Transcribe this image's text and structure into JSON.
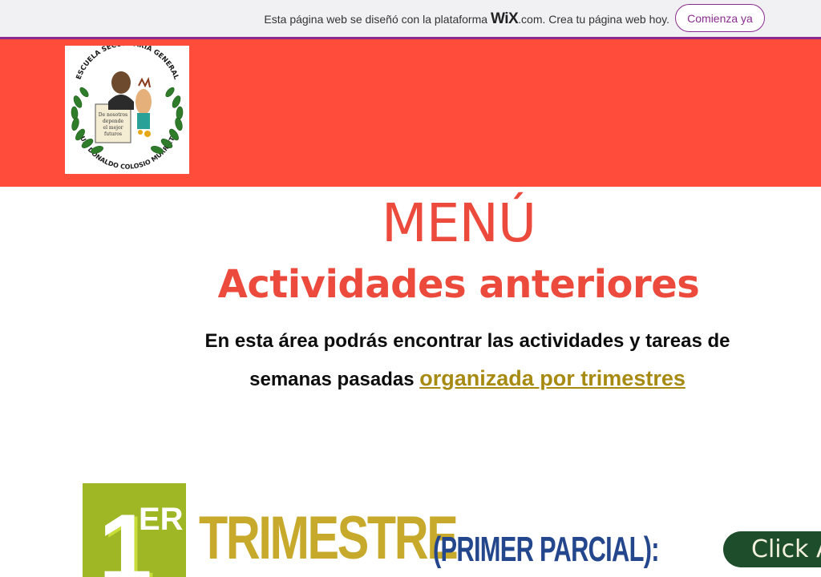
{
  "wix_banner": {
    "message_before": "Esta página web se diseñó con la plataforma ",
    "brand": "WiX",
    "message_after": ".com. Crea tu página web hoy.",
    "cta_label": "Comienza ya",
    "accent_color": "#8a2c8f"
  },
  "header": {
    "background_color": "#ff4c3b",
    "logo": {
      "top_text": "ESCUELA SECUNDARIA GENERAL",
      "bottom_text": "LUIS DONALDO COLOSIO MURRIETA",
      "scroll_text": "\"De nosotros depende el mejor de los futuros\""
    }
  },
  "main": {
    "title": "MENÚ",
    "subtitle": "Actividades anteriores",
    "intro_text": "En esta área podrás encontrar las actividades y tareas de semanas pasadas ",
    "intro_link": "organizada por trimestres",
    "accent_color": "#ec4a3c"
  },
  "trimester": {
    "badge_number": "1",
    "badge_suffix": "ER",
    "title": "TRIMESTRE",
    "subtitle": "(PRIMER PARCIAL):",
    "button_label": "Click A"
  }
}
